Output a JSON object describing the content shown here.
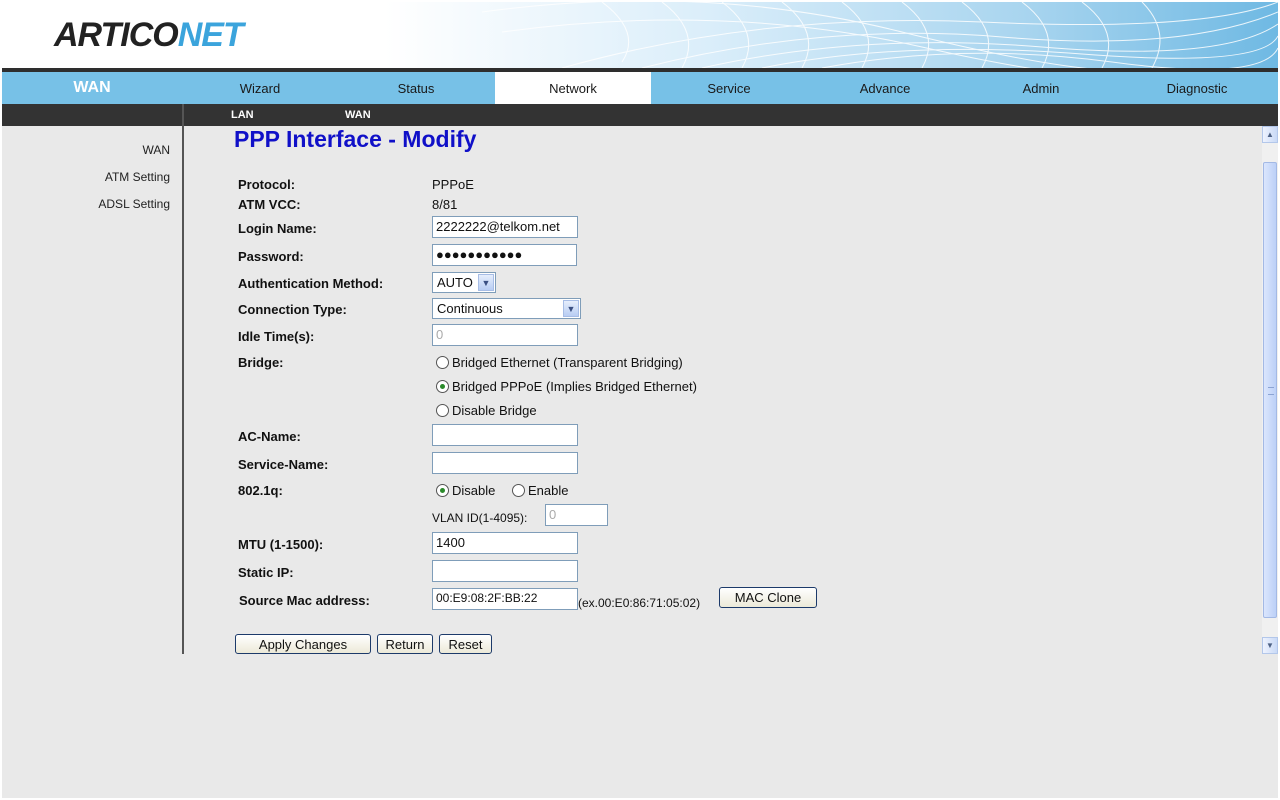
{
  "header": {
    "logo_part1": "ARTICO",
    "logo_part2": "NET"
  },
  "nav": {
    "section": "WAN",
    "items": [
      "Wizard",
      "Status",
      "Network",
      "Service",
      "Advance",
      "Admin",
      "Diagnostic"
    ],
    "active": "Network"
  },
  "subnav": {
    "items": [
      "LAN",
      "WAN"
    ]
  },
  "sidebar": {
    "items": [
      "WAN",
      "ATM Setting",
      "ADSL Setting"
    ]
  },
  "form": {
    "title": "PPP Interface - Modify",
    "protocol_label": "Protocol:",
    "protocol_value": "PPPoE",
    "atm_vcc_label": "ATM VCC:",
    "atm_vcc_value": "8/81",
    "login_label": "Login Name:",
    "login_value": "2222222@telkom.net",
    "password_label": "Password:",
    "password_value": "●●●●●●●●●●●",
    "auth_label": "Authentication Method:",
    "auth_value": "AUTO",
    "conn_type_label": "Connection Type:",
    "conn_type_value": "Continuous",
    "idle_label": "Idle Time(s):",
    "idle_value": "0",
    "bridge_label": "Bridge:",
    "bridge_options": [
      "Bridged Ethernet (Transparent Bridging)",
      "Bridged PPPoE (Implies Bridged Ethernet)",
      "Disable Bridge"
    ],
    "bridge_selected": "Bridged PPPoE (Implies Bridged Ethernet)",
    "ac_name_label": "AC-Name:",
    "ac_name_value": "",
    "service_name_label": "Service-Name:",
    "service_name_value": "",
    "dot1q_label": "802.1q:",
    "dot1q_options": [
      "Disable",
      "Enable"
    ],
    "dot1q_selected": "Disable",
    "vlan_label": "VLAN ID(1-4095):",
    "vlan_value": "0",
    "mtu_label": "MTU (1-1500):",
    "mtu_value": "1400",
    "static_ip_label": "Static IP:",
    "static_ip_value": "",
    "mac_label": "Source Mac address:",
    "mac_value": "00:E9:08:2F:BB:22",
    "mac_hint": "(ex.00:E0:86:71:05:02)",
    "mac_clone_button": "MAC Clone"
  },
  "buttons": {
    "apply": "Apply Changes",
    "return": "Return",
    "reset": "Reset"
  },
  "colors": {
    "nav_bar": "#77c1e7",
    "title": "#1010c8",
    "subnav": "#333333",
    "background": "#e9e9e9"
  }
}
